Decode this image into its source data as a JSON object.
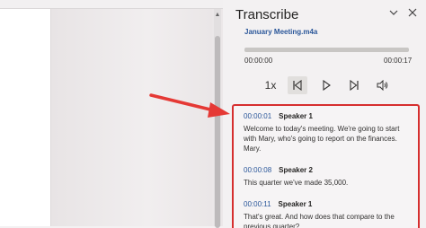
{
  "pane": {
    "title": "Transcribe",
    "file_name": "January Meeting.m4a",
    "progress_fraction": 0.0,
    "time_current": "00:00:00",
    "time_total": "00:00:17",
    "speed": "1x"
  },
  "transcript": [
    {
      "timestamp": "00:00:01",
      "speaker": "Speaker 1",
      "text": "Welcome to today's meeting. We're going to start with Mary, who's going to report on the finances. Mary."
    },
    {
      "timestamp": "00:00:08",
      "speaker": "Speaker 2",
      "text": "This quarter we've made 35,000."
    },
    {
      "timestamp": "00:00:11",
      "speaker": "Speaker 1",
      "text": "That's great. And how does that compare to the previous quarter?"
    }
  ],
  "colors": {
    "highlight": "#d62f2f",
    "link": "#2b579a",
    "arrow": "#e53935"
  },
  "icons": [
    "chevron-down-icon",
    "close-icon",
    "skip-back-icon",
    "play-icon",
    "skip-forward-icon",
    "volume-icon"
  ]
}
